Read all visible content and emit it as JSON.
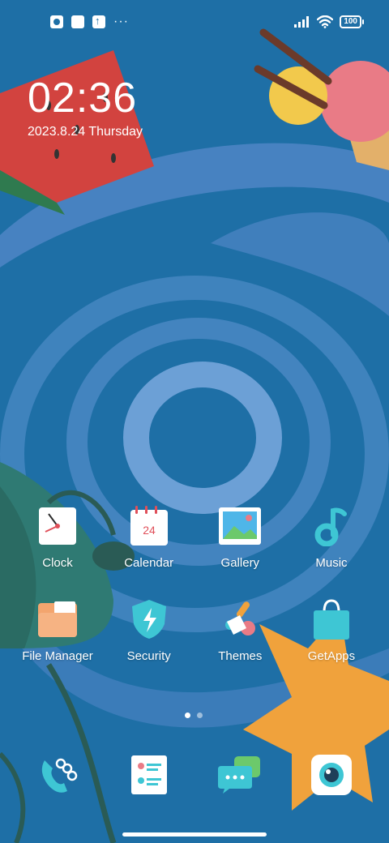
{
  "status_bar": {
    "dots": "···",
    "battery": "100"
  },
  "lock_widget": {
    "time": "02:36",
    "date": "2023.8.24 Thursday"
  },
  "apps": [
    {
      "label": "Clock",
      "icon": "clock-icon"
    },
    {
      "label": "Calendar",
      "icon": "calendar-icon",
      "icon_text": "24"
    },
    {
      "label": "Gallery",
      "icon": "gallery-icon"
    },
    {
      "label": "Music",
      "icon": "music-icon"
    },
    {
      "label": "File Manager",
      "icon": "folder-icon"
    },
    {
      "label": "Security",
      "icon": "shield-icon"
    },
    {
      "label": "Themes",
      "icon": "paintbrush-icon"
    },
    {
      "label": "GetApps",
      "icon": "shopping-bag-icon"
    }
  ],
  "dock": [
    {
      "icon": "phone-icon"
    },
    {
      "icon": "contacts-icon"
    },
    {
      "icon": "messages-icon"
    },
    {
      "icon": "camera-icon"
    }
  ],
  "page_indicator": {
    "pages": 2,
    "active": 1
  },
  "colors": {
    "background": "#1e6fa6",
    "swirl": "#5b93d0",
    "accent_teal": "#3ec6d4",
    "accent_orange": "#f0a23c",
    "accent_red": "#d2433f"
  }
}
